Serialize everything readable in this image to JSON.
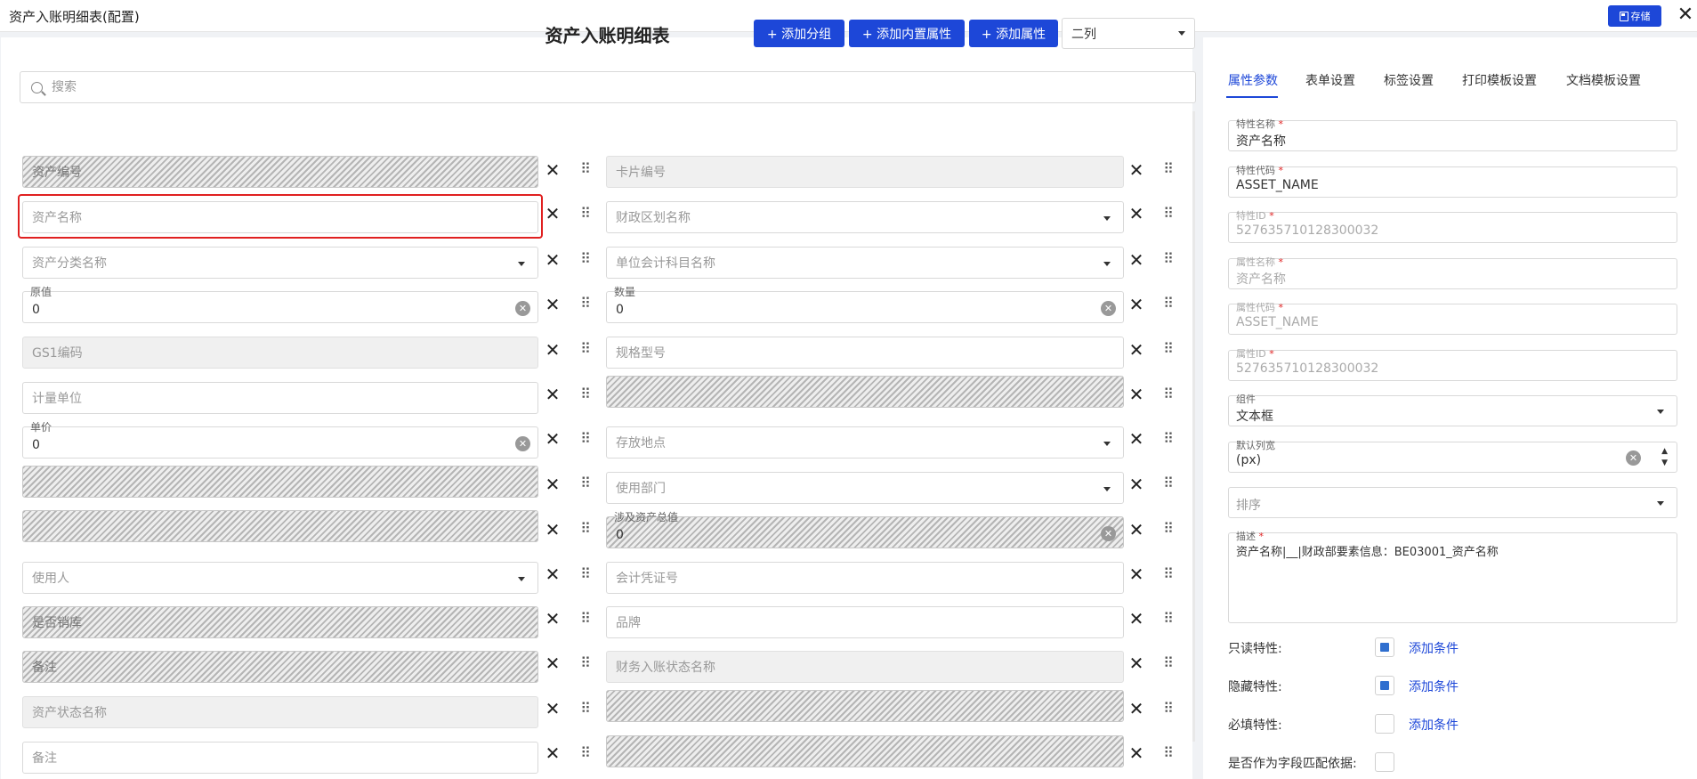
{
  "window": {
    "title": "资产入账明细表(配置)",
    "save_label": "存储",
    "close_glyph": "✕"
  },
  "toolbar": {
    "form_title": "资产入账明细表",
    "add_group": "+ 添加分组",
    "add_builtin": "+ 添加内置属性",
    "add_attr": "+ 添加属性",
    "columns_value": "二列"
  },
  "search": {
    "placeholder": "搜索"
  },
  "fields": [
    {
      "label": "资产编号",
      "style": "hatch"
    },
    {
      "label": "卡片编号",
      "style": "gray"
    },
    {
      "label": "资产名称",
      "style": "selected"
    },
    {
      "label": "财政区划名称",
      "style": "select"
    },
    {
      "label": "资产分类名称",
      "style": "select"
    },
    {
      "label": "单位会计科目名称",
      "style": "select"
    },
    {
      "label": "原值",
      "value": "0",
      "style": "number"
    },
    {
      "label": "数量",
      "value": "0",
      "style": "number"
    },
    {
      "label": "GS1编码",
      "style": "gray"
    },
    {
      "label": "规格型号",
      "style": "plain"
    },
    {
      "label": "计量单位",
      "style": "plain"
    },
    {
      "label": "",
      "style": "hatch"
    },
    {
      "label": "单价",
      "value": "0",
      "style": "number"
    },
    {
      "label": "存放地点",
      "style": "select"
    },
    {
      "label": "",
      "style": "hatch"
    },
    {
      "label": "使用部门",
      "style": "select"
    },
    {
      "label": "",
      "style": "hatch"
    },
    {
      "label": "涉及资产总值",
      "value": "0",
      "style": "hatch-number"
    },
    {
      "label": "使用人",
      "style": "select"
    },
    {
      "label": "会计凭证号",
      "style": "plain"
    },
    {
      "label": "是否销库",
      "style": "hatch"
    },
    {
      "label": "品牌",
      "style": "plain"
    },
    {
      "label": "备注",
      "style": "hatch"
    },
    {
      "label": "财务入账状态名称",
      "style": "gray"
    },
    {
      "label": "资产状态名称",
      "style": "gray"
    },
    {
      "label": "",
      "style": "hatch"
    },
    {
      "label": "备注",
      "style": "plain"
    },
    {
      "label": "",
      "style": "hatch"
    }
  ],
  "tabs": [
    "属性参数",
    "表单设置",
    "标签设置",
    "打印模板设置",
    "文档模板设置"
  ],
  "props": {
    "feature_name": {
      "label": "特性名称",
      "value": "资产名称"
    },
    "feature_code": {
      "label": "特性代码",
      "value": "ASSET_NAME"
    },
    "feature_id": {
      "label": "特性ID",
      "value": "527635710128300032"
    },
    "attr_name": {
      "label": "属性名称",
      "value": "资产名称"
    },
    "attr_code": {
      "label": "属性代码",
      "value": "ASSET_NAME"
    },
    "attr_id": {
      "label": "属性ID",
      "value": "527635710128300032"
    },
    "component": {
      "label": "组件",
      "value": "文本框"
    },
    "col_width": {
      "label": "默认列宽",
      "value": "(px)"
    },
    "sort": {
      "placeholder": "排序"
    },
    "desc": {
      "label": "描述",
      "value": "资产名称|__|财政部要素信息：BE03001_资产名称"
    },
    "readonly": {
      "label": "只读特性:",
      "checked": true,
      "link": "添加条件"
    },
    "hidden": {
      "label": "隐藏特性:",
      "checked": true,
      "link": "添加条件"
    },
    "required": {
      "label": "必填特性:",
      "checked": false,
      "link": "添加条件"
    },
    "match_basis": {
      "label": "是否作为字段匹配依据:",
      "checked": false
    }
  }
}
